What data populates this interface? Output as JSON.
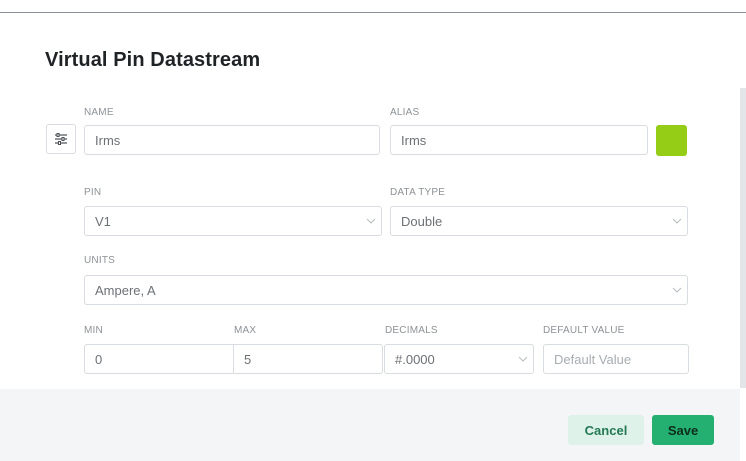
{
  "dialog": {
    "title": "Virtual Pin Datastream"
  },
  "fields": {
    "name": {
      "label": "NAME",
      "value": "Irms"
    },
    "alias": {
      "label": "ALIAS",
      "value": "Irms"
    },
    "pin": {
      "label": "PIN",
      "value": "V1"
    },
    "data_type": {
      "label": "DATA TYPE",
      "value": "Double"
    },
    "units": {
      "label": "UNITS",
      "value": "Ampere, A"
    },
    "min": {
      "label": "MIN",
      "value": "0"
    },
    "max": {
      "label": "MAX",
      "value": "5"
    },
    "decimals": {
      "label": "DECIMALS",
      "value": "#.0000"
    },
    "default_value": {
      "label": "DEFAULT VALUE",
      "placeholder": "Default Value"
    }
  },
  "color_swatch": {
    "color": "#94cc16"
  },
  "icons": {
    "settings": "sliders-icon",
    "dropdown": "chevron-down-icon"
  },
  "buttons": {
    "cancel": "Cancel",
    "save": "Save"
  },
  "theme": {
    "accent": "#23b070",
    "cancel_bg": "#dff2ea"
  }
}
